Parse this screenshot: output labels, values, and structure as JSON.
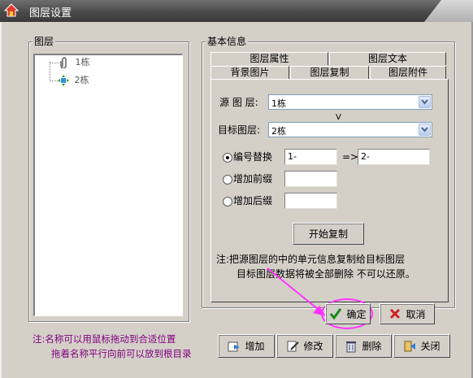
{
  "window": {
    "title": "图层设置"
  },
  "layers_group": {
    "legend": "图层",
    "items": [
      {
        "label": "1栋",
        "icon": "paperclip-icon"
      },
      {
        "label": "2栋",
        "icon": "layer-move-icon"
      }
    ]
  },
  "info_group": {
    "legend": "基本信息",
    "tabs_row1": [
      "图层属性",
      "图层文本"
    ],
    "tabs_row2": [
      "背景图片",
      "图层复制",
      "图层附件"
    ],
    "active_tab": "图层复制"
  },
  "copy_tab": {
    "source_label": "源 图 层:",
    "source_value": "1栋",
    "arrow_text": "V",
    "target_label": "目标图层:",
    "target_value": "2栋",
    "options": [
      {
        "label": "编号替换",
        "selected": true,
        "from": "1-",
        "arrow": "=>",
        "to": "2-"
      },
      {
        "label": "增加前缀",
        "selected": false,
        "value": ""
      },
      {
        "label": "增加后缀",
        "selected": false,
        "value": ""
      }
    ],
    "start_button": "开始复制",
    "note_line1": "注:把源图层的中的单元信息复制给目标图层",
    "note_line2": "目标图层数据将被全部删除 不可以还原。"
  },
  "dialog_buttons": {
    "ok": "确定",
    "cancel": "取消"
  },
  "bottom_note": {
    "line1": "注:名称可以用鼠标拖动到合适位置",
    "line2": "拖着名称平行向前可以放到根目录"
  },
  "bottom_buttons": {
    "add": "增加",
    "edit": "修改",
    "delete": "删除",
    "close": "关闭"
  },
  "colors": {
    "accent_highlight": "#ff33ff",
    "note_purple": "#800080",
    "ok_check": "#1a8a1a",
    "cancel_x": "#cc2222"
  }
}
